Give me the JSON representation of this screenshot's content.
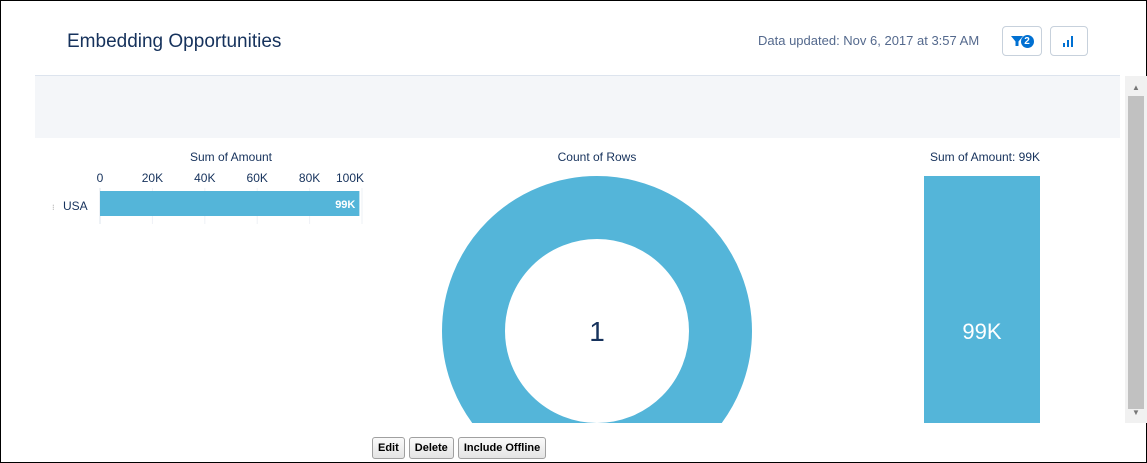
{
  "header": {
    "title": "Embedding Opportunities",
    "data_updated": "Data updated: Nov 6, 2017 at 3:57 AM",
    "filter_count": "2",
    "filter_icon": "funnel-icon",
    "chart_icon": "bar-chart-icon"
  },
  "colors": {
    "bar": "#54b5d9",
    "text": "#16325c"
  },
  "chart_data": [
    {
      "type": "bar",
      "orientation": "horizontal",
      "title": "Sum of Amount",
      "categories": [
        "USA"
      ],
      "values": [
        99000
      ],
      "value_labels": [
        "99K"
      ],
      "xticks": [
        "0",
        "20K",
        "40K",
        "60K",
        "80K",
        "100K"
      ],
      "xlim": [
        0,
        100000
      ]
    },
    {
      "type": "pie",
      "variant": "donut",
      "title": "Count of Rows",
      "values": [
        1
      ],
      "center_label": "1"
    },
    {
      "type": "bar",
      "title": "Sum of Amount: 99K",
      "values": [
        99000
      ],
      "value_labels": [
        "99K"
      ]
    }
  ],
  "buttons": {
    "edit": "Edit",
    "delete": "Delete",
    "include_offline": "Include Offline"
  },
  "scrollbar": {
    "up": "▲",
    "down": "▼"
  }
}
